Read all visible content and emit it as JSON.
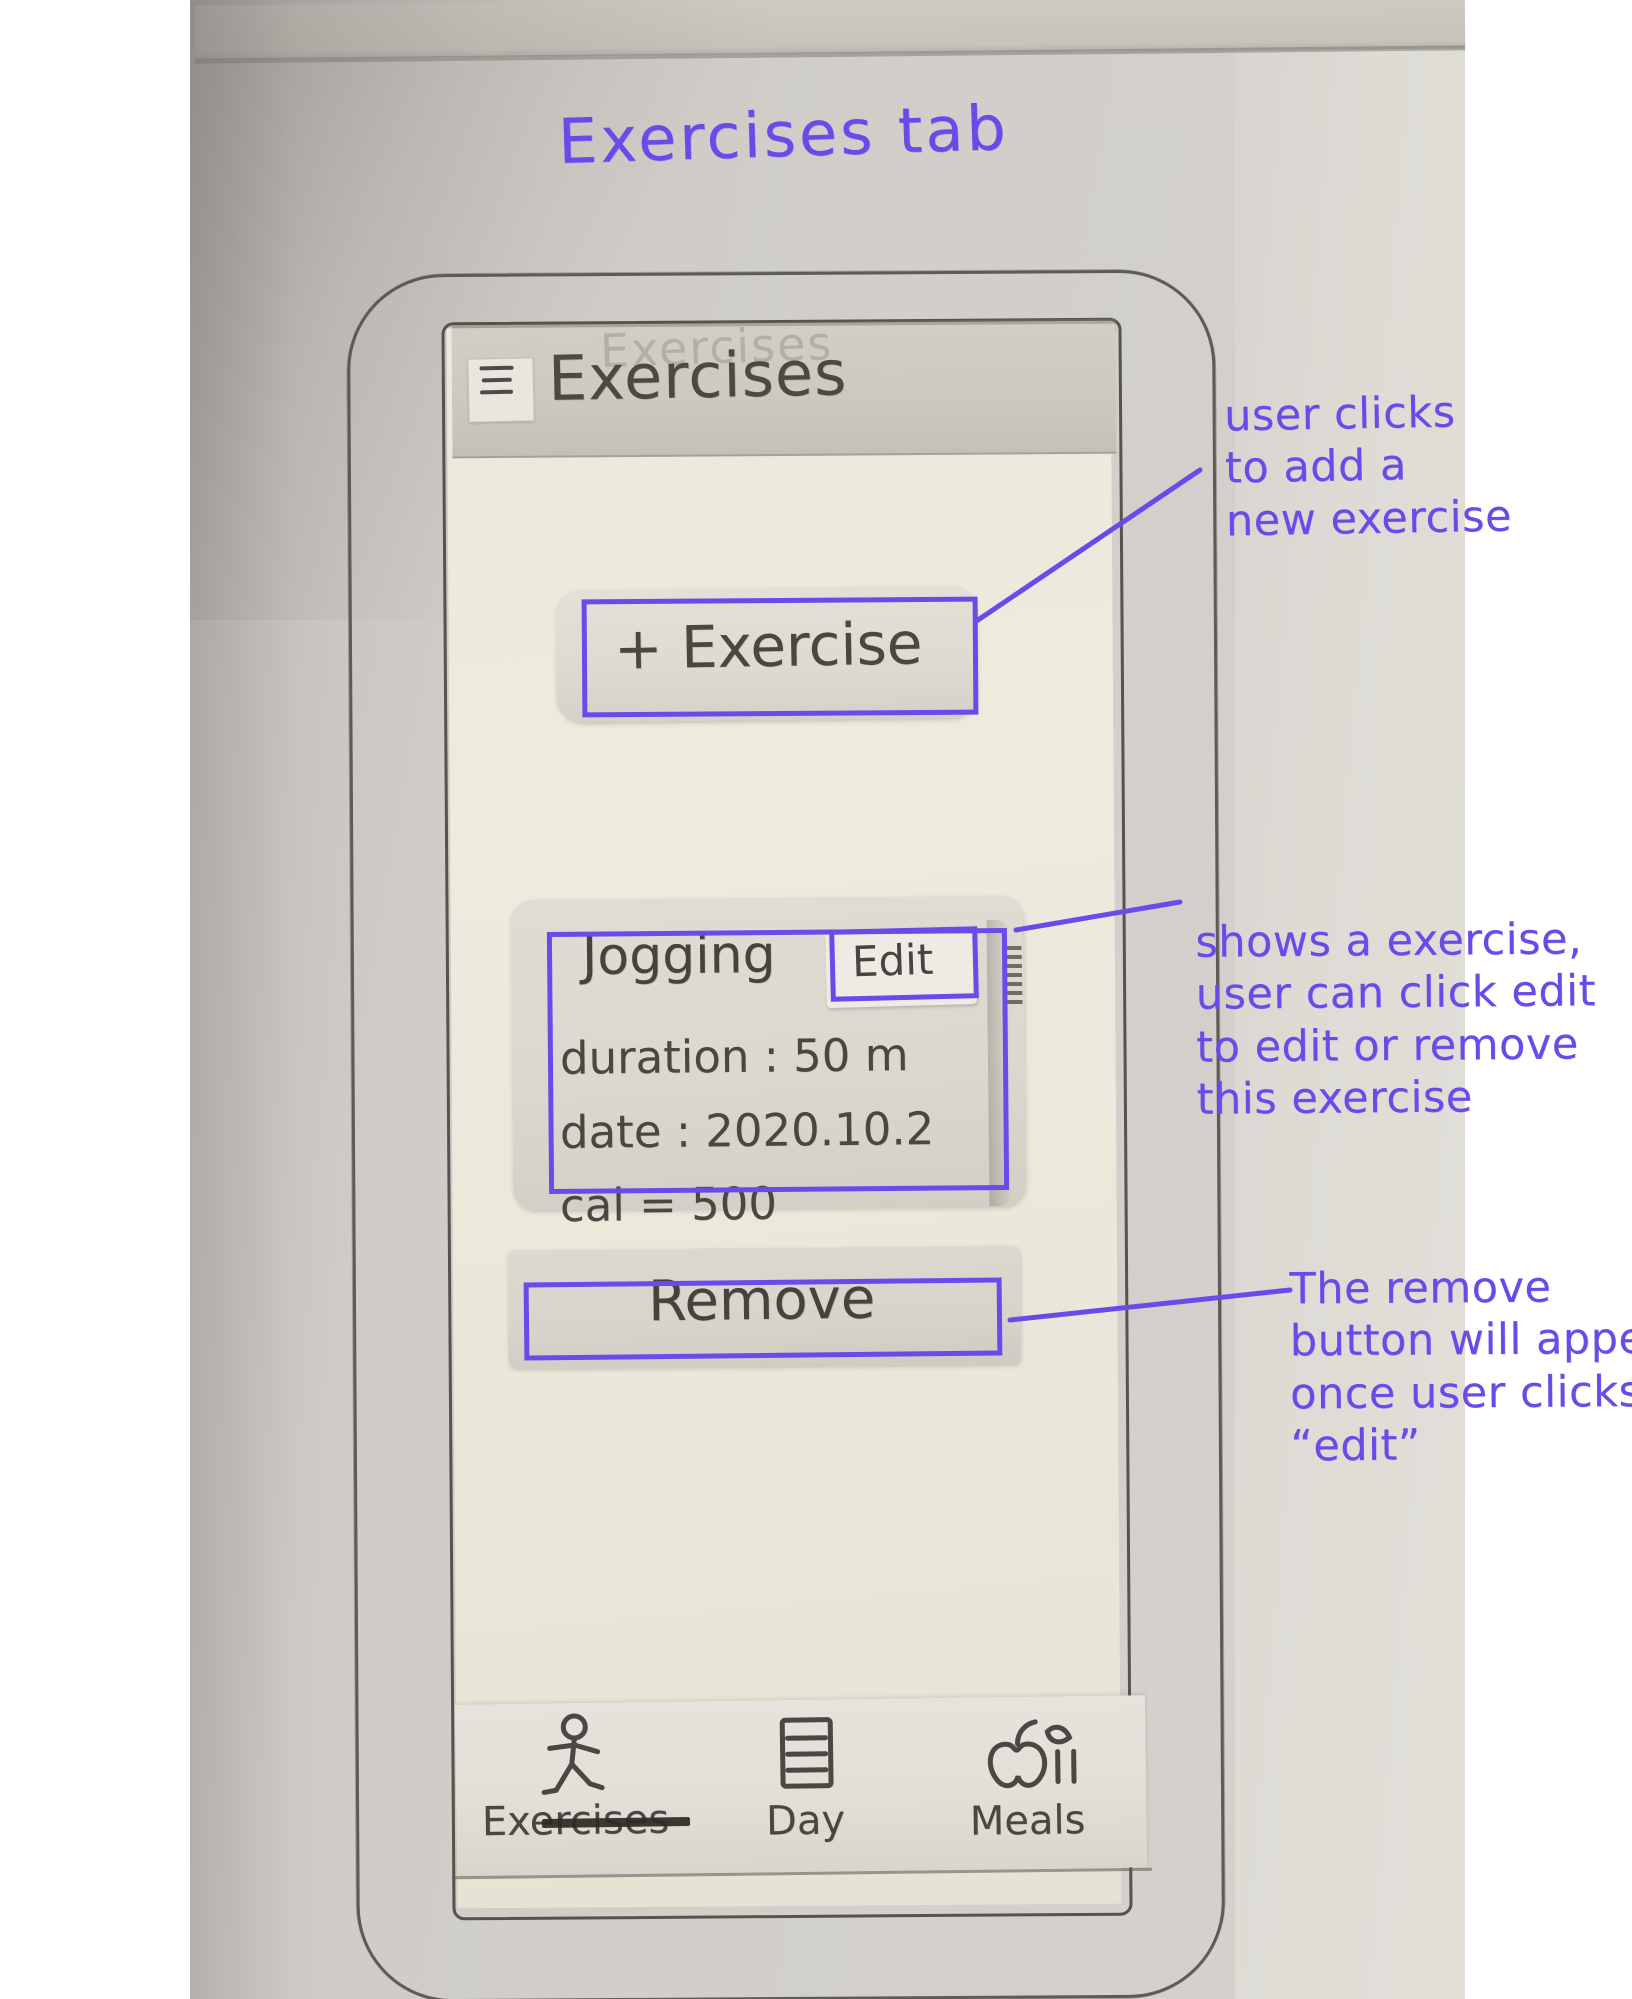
{
  "sketch": {
    "title": "Exercises tab",
    "medium": "hand-drawn paper prototype photo"
  },
  "phone": {
    "appbar": {
      "menu_icon": "hamburger-menu-icon",
      "title": "Exercises",
      "ghost_title": "Exercises"
    },
    "add_button": {
      "icon": "plus-icon",
      "label": "+ Exercise"
    },
    "exercise_card": {
      "name": "Jogging",
      "edit_label": "Edit",
      "scroll_mark": "scrollbar-mark",
      "details": [
        {
          "key": "duration",
          "sep": ":",
          "value": "50 m",
          "text": "duration :  50 m"
        },
        {
          "key": "date",
          "sep": ":",
          "value": "2020.10.2",
          "text": "date :  2020.10.2"
        },
        {
          "key": "cal",
          "sep": "=",
          "value": "500",
          "text": "cal  =  500"
        }
      ]
    },
    "remove_button": {
      "label": "Remove"
    },
    "tabbar": {
      "tabs": [
        {
          "label": "Exercises",
          "icon": "running-person-icon",
          "active": true
        },
        {
          "label": "Day",
          "icon": "list-calendar-icon",
          "active": false
        },
        {
          "label": "Meals",
          "icon": "apple-fruit-icon",
          "active": false
        }
      ]
    }
  },
  "annotations": {
    "ink_color": "#6a4bea",
    "note_add": "user clicks\nto add a\nnew exercise",
    "note_card": "shows a exercise,\nuser can click edit\nto edit or remove\nthis exercise",
    "note_remove": "The remove\nbutton will appear\nonce user clicks\n“edit”"
  }
}
